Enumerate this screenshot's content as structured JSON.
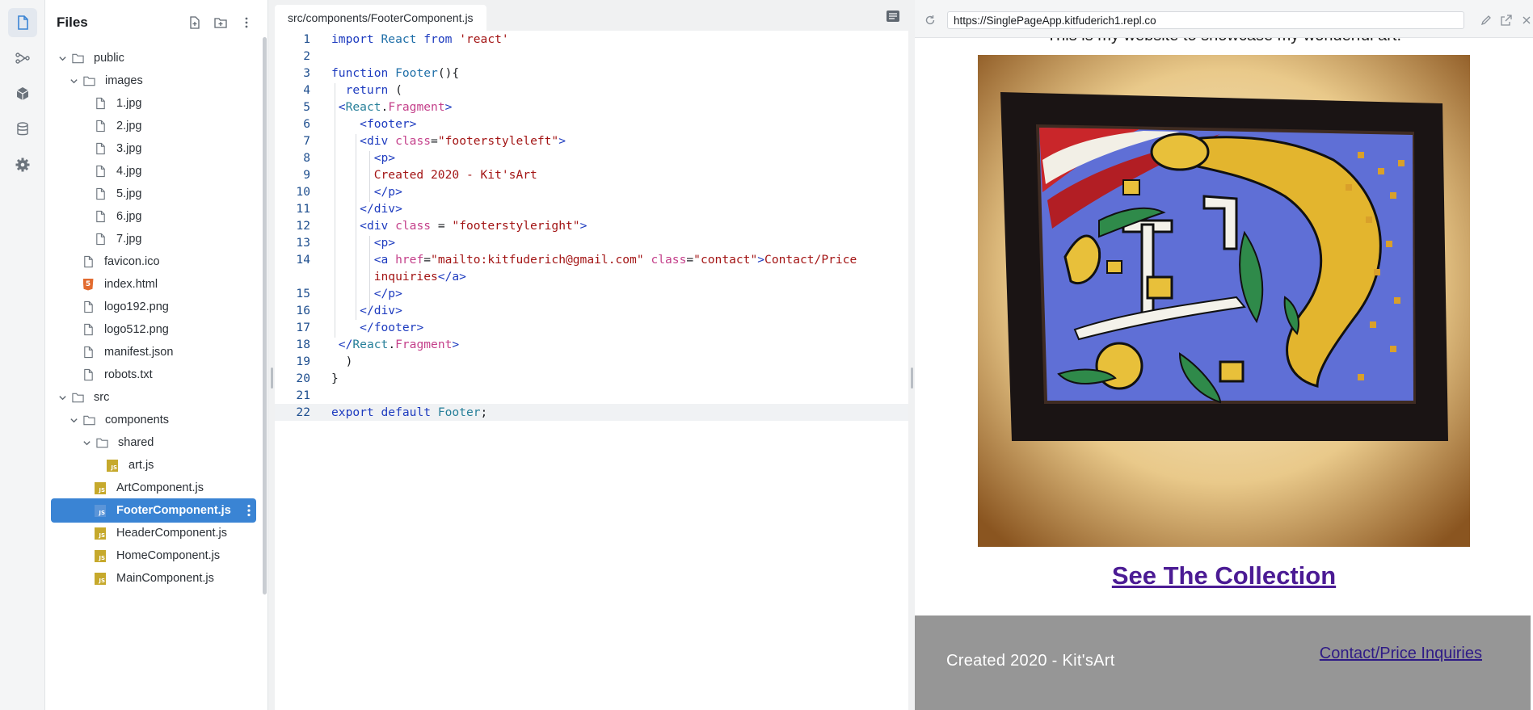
{
  "files_panel": {
    "title": "Files"
  },
  "tree": [
    {
      "label": "public",
      "type": "folder",
      "expanded": true
    },
    {
      "label": "images",
      "type": "folder",
      "expanded": true
    },
    {
      "label": "1.jpg",
      "type": "file"
    },
    {
      "label": "2.jpg",
      "type": "file"
    },
    {
      "label": "3.jpg",
      "type": "file"
    },
    {
      "label": "4.jpg",
      "type": "file"
    },
    {
      "label": "5.jpg",
      "type": "file"
    },
    {
      "label": "6.jpg",
      "type": "file"
    },
    {
      "label": "7.jpg",
      "type": "file"
    },
    {
      "label": "favicon.ico",
      "type": "file"
    },
    {
      "label": "index.html",
      "type": "html"
    },
    {
      "label": "logo192.png",
      "type": "file"
    },
    {
      "label": "logo512.png",
      "type": "file"
    },
    {
      "label": "manifest.json",
      "type": "file"
    },
    {
      "label": "robots.txt",
      "type": "file"
    },
    {
      "label": "src",
      "type": "folder",
      "expanded": true
    },
    {
      "label": "components",
      "type": "folder",
      "expanded": true
    },
    {
      "label": "shared",
      "type": "folder",
      "expanded": true
    },
    {
      "label": "art.js",
      "type": "js"
    },
    {
      "label": "ArtComponent.js",
      "type": "js"
    },
    {
      "label": "FooterComponent.js",
      "type": "js",
      "selected": true
    },
    {
      "label": "HeaderComponent.js",
      "type": "js"
    },
    {
      "label": "HomeComponent.js",
      "type": "js"
    },
    {
      "label": "MainComponent.js",
      "type": "js"
    }
  ],
  "editor": {
    "tab_label": "src/components/FooterComponent.js",
    "line_numbers": [
      "1",
      "2",
      "3",
      "4",
      "5",
      "6",
      "7",
      "8",
      "9",
      "10",
      "11",
      "12",
      "13",
      "14",
      "15",
      "16",
      "17",
      "18",
      "19",
      "20",
      "21",
      "22"
    ],
    "current_line": "22",
    "code": {
      "l1_import": "import",
      "l1_react": "React",
      "l1_from": "from",
      "l1_str": "'react'",
      "l3_function": "function",
      "l3_name": "Footer",
      "l3_rest": "(){",
      "l4_return": "return",
      "l4_paren": "(",
      "l5_open": "<",
      "l5_react": "React",
      "l5_dot": ".",
      "l5_frag": "Fragment",
      "l5_close": ">",
      "l6_tag": "<footer>",
      "l7_open": "<div",
      "l7_attr": "class",
      "l7_eq": "=",
      "l7_val": "\"footerstyleleft\"",
      "l7_close": ">",
      "l8_tag": "<p>",
      "l9_text": "Created 2020 - Kit'sArt",
      "l10_tag": "</p>",
      "l11_tag": "</div>",
      "l12_open": "<div",
      "l12_attr": "class",
      "l12_eq": " = ",
      "l12_val": "\"footerstyleright\"",
      "l12_close": ">",
      "l13_tag": "<p>",
      "l14_open": "<a",
      "l14_href": "href",
      "l14_eq": "=",
      "l14_hval": "\"mailto:kitfuderich@gmail.com\"",
      "l14_class": "class",
      "l14_eq2": "=",
      "l14_cval": "\"contact\"",
      "l14_gt": ">",
      "l14_text": "Contact/Price",
      "l14b_text": "inquiries",
      "l14b_tag": "</a>",
      "l15_tag": "</p>",
      "l16_tag": "</div>",
      "l17_tag": "</footer>",
      "l18_open": "</",
      "l18_react": "React",
      "l18_dot": ".",
      "l18_frag": "Fragment",
      "l18_close": ">",
      "l19_paren": ")",
      "l20_brace": "}",
      "l22_export": "export",
      "l22_default": "default",
      "l22_name": "Footer",
      "l22_semi": ";"
    }
  },
  "preview": {
    "url": "https://SinglePageApp.kitfuderich1.repl.co",
    "intro_text": "This is my website to showcase my wonderful art.",
    "collection_link": "See The Collection",
    "footer_left": "Created 2020 - Kit'sArt",
    "footer_right": "Contact/Price Inquiries"
  },
  "colors": {
    "selection": "#3a84d4",
    "footer_bg": "#969696",
    "link": "#4b1b94"
  }
}
